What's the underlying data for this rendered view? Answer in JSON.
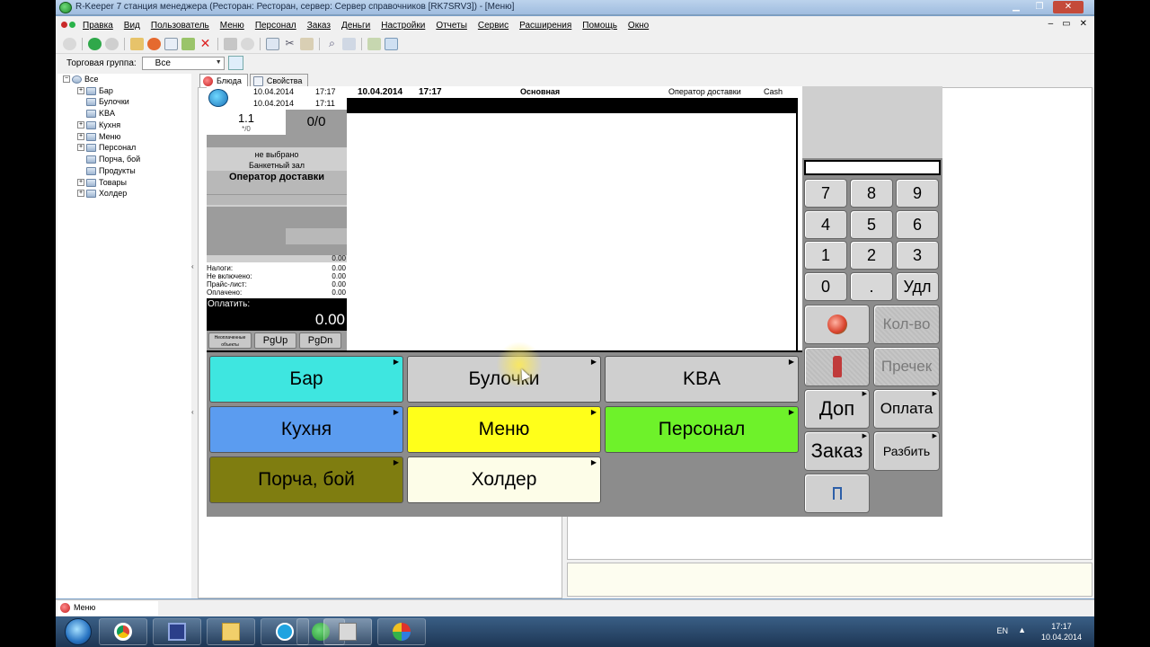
{
  "window": {
    "title": "R-Keeper 7 станция менеджера (Ресторан: Ресторан, сервер: Сервер справочников [RK7SRV3]) - [Меню]"
  },
  "menu": {
    "items": [
      "Правка",
      "Вид",
      "Пользователь",
      "Меню",
      "Персонал",
      "Заказ",
      "Деньги",
      "Настройки",
      "Отчеты",
      "Сервис",
      "Расширения",
      "Помощь",
      "Окно"
    ]
  },
  "groupbar": {
    "label": "Торговая группа:",
    "value": "Все"
  },
  "tree": {
    "root": "Все",
    "items": [
      "Бар",
      "Булочки",
      "KBA",
      "Кухня",
      "Меню",
      "Персонал",
      "Порча, бой",
      "Продукты",
      "Товары",
      "Холдер"
    ]
  },
  "tabs": [
    {
      "label": "Блюда"
    },
    {
      "label": "Свойства"
    }
  ],
  "pos": {
    "header": {
      "date1": "10.04.2014",
      "time1": "17:17",
      "date2": "10.04.2014",
      "time2": "17:11"
    },
    "stat": {
      "guests": "1.1",
      "sub": "*/0",
      "count": "0/0"
    },
    "not_selected": "не выбрано",
    "hall": "Банкетный зал",
    "operator": "Оператор доставки",
    "sum_small": "0.00",
    "totals": [
      {
        "label": "Налоги:",
        "value": "0.00"
      },
      {
        "label": "Не включено:",
        "value": "0.00"
      },
      {
        "label": "Прайс-лист:",
        "value": "0.00"
      },
      {
        "label": "Оплачено:",
        "value": "0.00"
      }
    ],
    "pay_label": "Оплатить:",
    "pay_value": "0.00",
    "nav": {
      "objects": "Неоплаченные объекты",
      "pgup": "PgUp",
      "pgdn": "PgDn"
    },
    "order_header": {
      "date": "10.04.2014",
      "time": "17:17",
      "menu": "Основная",
      "operator": "Оператор доставки",
      "cash": "Cash"
    },
    "keypad": [
      "7",
      "8",
      "9",
      "4",
      "5",
      "6",
      "1",
      "2",
      "3",
      "0",
      ".",
      "Удл"
    ],
    "functions": {
      "qty": "Кол-во",
      "precheck": "Пречек",
      "extra": "Доп",
      "payment": "Оплата",
      "order": "Заказ",
      "split": "Разбить"
    },
    "categories": [
      {
        "label": "Бар",
        "color": "#3ee6e0"
      },
      {
        "label": "Булочки",
        "color": "#cfcfcf"
      },
      {
        "label": "KBA",
        "color": "#cfcfcf"
      },
      {
        "label": "Кухня",
        "color": "#5b9cf0"
      },
      {
        "label": "Меню",
        "color": "#ffff1a"
      },
      {
        "label": "Персонал",
        "color": "#6ef22a"
      },
      {
        "label": "Порча, бой",
        "color": "#7f7d10"
      },
      {
        "label": "Холдер",
        "color": "#fdfde8"
      }
    ]
  },
  "statusbar": {
    "window": "Меню"
  },
  "taskbar": {
    "lang": "EN",
    "time": "17:17",
    "date": "10.04.2014"
  }
}
